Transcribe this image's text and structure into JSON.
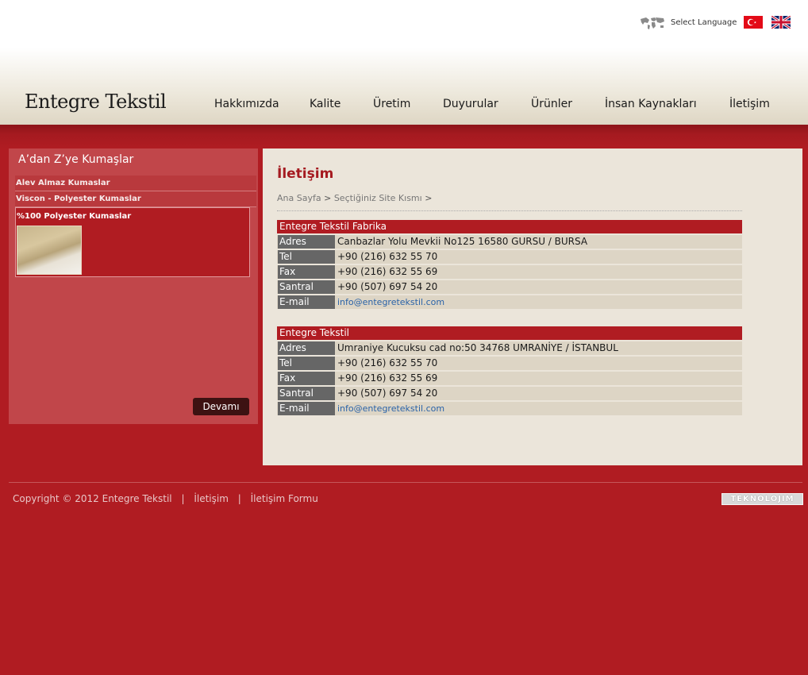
{
  "language": {
    "label": "Select Language",
    "flags": [
      "turkish-flag",
      "english-flag"
    ]
  },
  "header": {
    "logo": "Entegre Tekstil",
    "nav": [
      "Hakkımızda",
      "Kalite",
      "Üretim",
      "Duyurular",
      "Ürünler",
      "İnsan Kaynakları",
      "İletişim"
    ]
  },
  "sidebar": {
    "title": "A’dan Z’ye Kumaşlar",
    "items": [
      "Alev Almaz Kumaslar",
      "Viscon - Polyester Kumaslar",
      "%100 Polyester Kumaslar"
    ],
    "more_button": "Devamı"
  },
  "content": {
    "title": "İletişim",
    "breadcrumb": {
      "home": "Ana Sayfa",
      "sep": ">",
      "current": "Seçtiğiniz Site Kısmı"
    },
    "blocks": [
      {
        "title": "Entegre Tekstil Fabrika",
        "rows": [
          {
            "key": "Adres",
            "value": "Canbazlar Yolu Mevkii No125 16580 GURSU / BURSA"
          },
          {
            "key": "Tel",
            "value": "+90 (216) 632 55 70"
          },
          {
            "key": "Fax",
            "value": "+90 (216) 632 55 69"
          },
          {
            "key": "Santral",
            "value": "+90 (507) 697 54 20"
          },
          {
            "key": "E-mail",
            "value": "info@entegretekstil.com"
          }
        ]
      },
      {
        "title": "Entegre Tekstil",
        "rows": [
          {
            "key": "Adres",
            "value": "Umraniye Kucuksu cad no:50 34768 UMRANİYE / İSTANBUL"
          },
          {
            "key": "Tel",
            "value": "+90 (216) 632 55 70"
          },
          {
            "key": "Fax",
            "value": "+90 (216) 632 55 69"
          },
          {
            "key": "Santral",
            "value": "+90 (507) 697 54 20"
          },
          {
            "key": "E-mail",
            "value": "info@entegretekstil.com"
          }
        ]
      }
    ]
  },
  "footer": {
    "copyright": "Copyright © 2012 Entegre Tekstil",
    "sep": "|",
    "links": [
      "İletişim",
      "İletişim Formu"
    ],
    "badge": "TEKNOLOJIM"
  },
  "colors": {
    "brand_red": "#b01c22",
    "content_bg": "#ebe5da",
    "link_blue": "#2a63a8"
  }
}
